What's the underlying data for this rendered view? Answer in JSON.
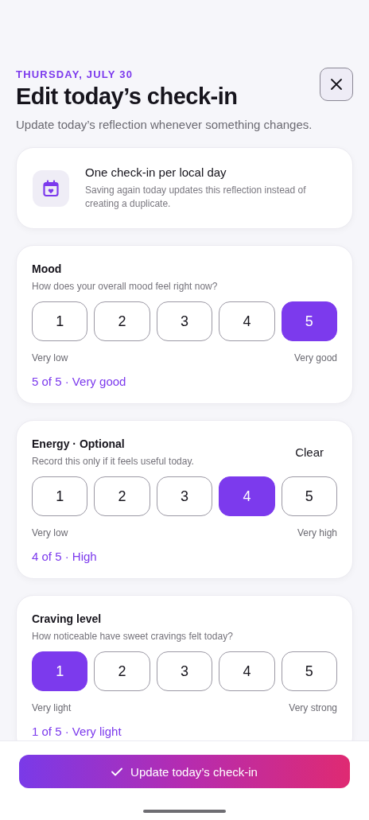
{
  "header": {
    "date": "THURSDAY, JULY 30",
    "title": "Edit today’s check-in",
    "subtitle": "Update today’s reflection whenever something changes."
  },
  "info": {
    "title": "One check-in per local day",
    "text": "Saving again today updates this reflection instead of creating a duplicate."
  },
  "ratings": [
    {
      "title": "Mood",
      "question": "How does your overall mood feel right now?",
      "options": [
        {
          "label": "1",
          "selected": false
        },
        {
          "label": "2",
          "selected": false
        },
        {
          "label": "3",
          "selected": false
        },
        {
          "label": "4",
          "selected": false
        },
        {
          "label": "5",
          "selected": true
        }
      ],
      "low": "Very low",
      "high": "Very good",
      "summary": "5 of 5 · Very good"
    },
    {
      "title": "Energy · Optional",
      "question": "Record this only if it feels useful today.",
      "clear": "Clear",
      "options": [
        {
          "label": "1",
          "selected": false
        },
        {
          "label": "2",
          "selected": false
        },
        {
          "label": "3",
          "selected": false
        },
        {
          "label": "4",
          "selected": true
        },
        {
          "label": "5",
          "selected": false
        }
      ],
      "low": "Very low",
      "high": "Very high",
      "summary": "4 of 5 · High"
    },
    {
      "title": "Craving level",
      "question": "How noticeable have sweet cravings felt today?",
      "options": [
        {
          "label": "1",
          "selected": true
        },
        {
          "label": "2",
          "selected": false
        },
        {
          "label": "3",
          "selected": false
        },
        {
          "label": "4",
          "selected": false
        },
        {
          "label": "5",
          "selected": false
        }
      ],
      "low": "Very light",
      "high": "Very strong",
      "summary": "1 of 5 · Very light"
    }
  ],
  "save_button": {
    "label": "Update today’s check-in"
  }
}
